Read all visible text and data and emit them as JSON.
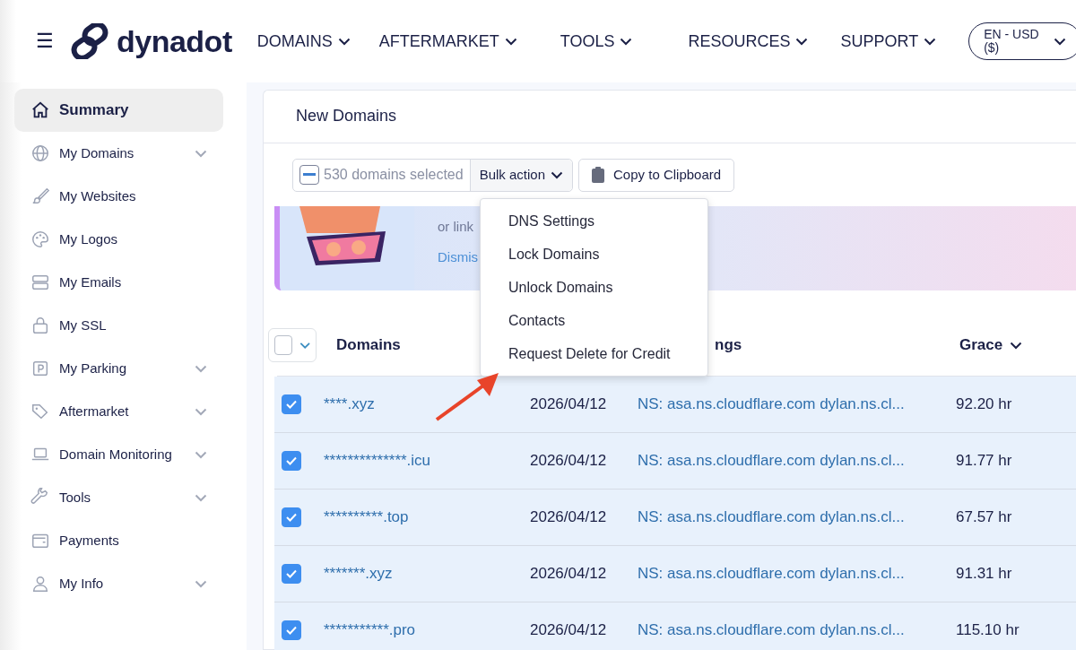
{
  "navbar": {
    "menu_button": "☰",
    "brand": "dynadot",
    "menu": [
      {
        "label": "DOMAINS"
      },
      {
        "label": "AFTERMARKET"
      },
      {
        "label": "TOOLS"
      },
      {
        "label": "RESOURCES"
      },
      {
        "label": "SUPPORT"
      }
    ],
    "language": "EN - USD ($)"
  },
  "sidebar": {
    "items": [
      {
        "label": "Summary",
        "selected": true,
        "expandable": false
      },
      {
        "label": "My Domains",
        "selected": false,
        "expandable": true
      },
      {
        "label": "My Websites",
        "selected": false,
        "expandable": false
      },
      {
        "label": "My Logos",
        "selected": false,
        "expandable": false
      },
      {
        "label": "My Emails",
        "selected": false,
        "expandable": false
      },
      {
        "label": "My SSL",
        "selected": false,
        "expandable": false
      },
      {
        "label": "My Parking",
        "selected": false,
        "expandable": true
      },
      {
        "label": "Aftermarket",
        "selected": false,
        "expandable": true
      },
      {
        "label": "Domain Monitoring",
        "selected": false,
        "expandable": true
      },
      {
        "label": "Tools",
        "selected": false,
        "expandable": true
      },
      {
        "label": "Payments",
        "selected": false,
        "expandable": false
      },
      {
        "label": "My Info",
        "selected": false,
        "expandable": true
      }
    ]
  },
  "card": {
    "title": "New Domains",
    "toolbar": {
      "partial": true,
      "selection": "530 domains selected",
      "bulk_action": "Bulk action",
      "copy": "Copy to Clipboard"
    },
    "bulk_menu": {
      "expanded": true,
      "items": [
        {
          "label": "DNS Settings"
        },
        {
          "label": "Lock Domains"
        },
        {
          "label": "Unlock Domains"
        },
        {
          "label": "Contacts"
        },
        {
          "label": "Request Delete for Credit"
        }
      ]
    },
    "banner": {
      "line_left": "or link",
      "dismiss": "Dismis"
    },
    "table": {
      "select_all": false,
      "columns": [
        {
          "label": "Domains"
        },
        {
          "label": "ngs"
        },
        {
          "label": "Grace",
          "sortable": true
        }
      ],
      "rows": [
        {
          "selected": true,
          "domain": "****.xyz",
          "date": "2026/04/12",
          "nameservers": "NS: asa.ns.cloudflare.com dylan.ns.cl...",
          "grace": "92.20 hr"
        },
        {
          "selected": true,
          "domain": "**************.icu",
          "date": "2026/04/12",
          "nameservers": "NS: asa.ns.cloudflare.com dylan.ns.cl...",
          "grace": "91.77 hr"
        },
        {
          "selected": true,
          "domain": "**********.top",
          "date": "2026/04/12",
          "nameservers": "NS: asa.ns.cloudflare.com dylan.ns.cl...",
          "grace": "67.57 hr"
        },
        {
          "selected": true,
          "domain": "*******.xyz",
          "date": "2026/04/12",
          "nameservers": "NS: asa.ns.cloudflare.com dylan.ns.cl...",
          "grace": "91.31 hr"
        },
        {
          "selected": true,
          "domain": "***********.pro",
          "date": "2026/04/12",
          "nameservers": "NS: asa.ns.cloudflare.com dylan.ns.cl...",
          "grace": "115.10 hr"
        }
      ]
    }
  }
}
